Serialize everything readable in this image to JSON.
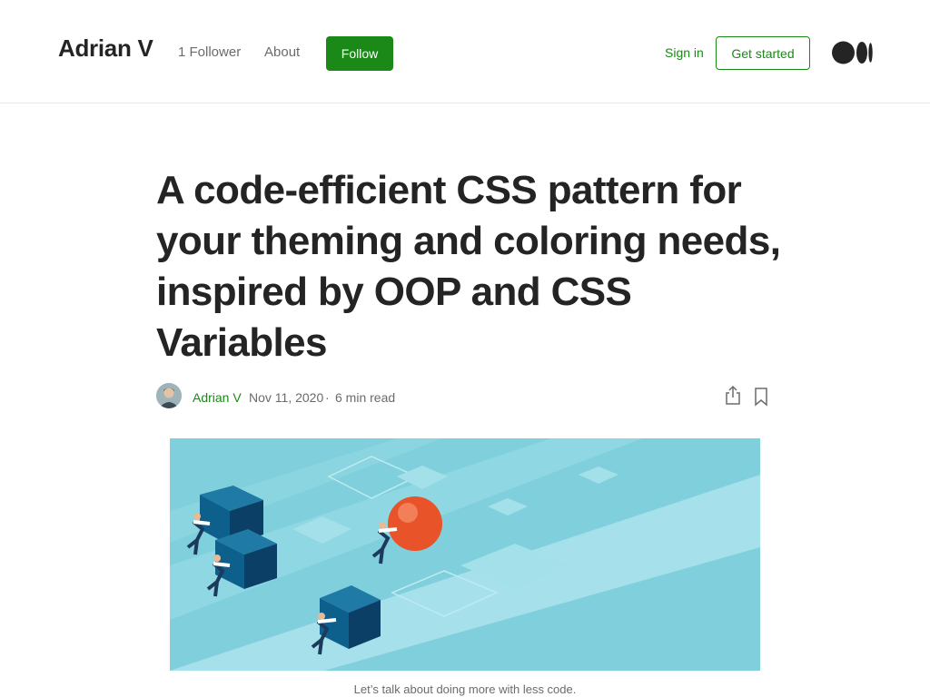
{
  "header": {
    "brand": "Adrian V",
    "followers": "1 Follower",
    "about": "About",
    "follow_label": "Follow",
    "sign_in": "Sign in",
    "get_started": "Get started",
    "logo_icon": "medium-logo-icon"
  },
  "article": {
    "title": "A code-efficient CSS pattern for your theming and coloring needs, inspired by OOP and CSS Variables",
    "author": "Adrian V",
    "date": "Nov 11, 2020",
    "separator": "·",
    "read_time": "6 min read",
    "share_icon": "share-icon",
    "bookmark_icon": "bookmark-icon",
    "hero_caption": "Let’s talk about doing more with less code."
  },
  "colors": {
    "accent_green": "#1a8917",
    "text": "#242424",
    "muted": "#6b6b6b",
    "hero_bg": "#7fd0dc",
    "block_dark": "#0f4f78",
    "ball_red": "#e8532a"
  }
}
